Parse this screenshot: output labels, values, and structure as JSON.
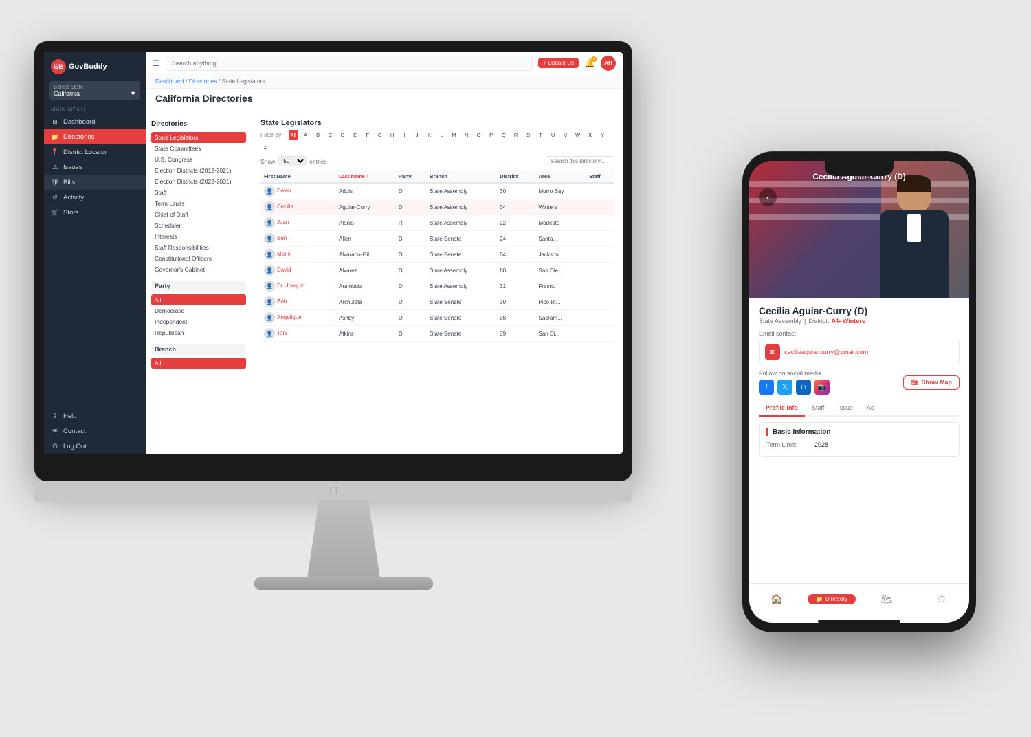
{
  "app": {
    "logo": "GovBuddy",
    "logo_icon": "GB",
    "search_placeholder": "Search anything..."
  },
  "state_selector": {
    "label": "Select State",
    "value": "California"
  },
  "sidebar": {
    "menu_label": "Main Menu",
    "items": [
      {
        "id": "dashboard",
        "label": "Dashboard",
        "icon": "⊞"
      },
      {
        "id": "directories",
        "label": "Directories",
        "icon": "📁",
        "active": true
      },
      {
        "id": "district-locator",
        "label": "District Locator",
        "icon": "📍"
      },
      {
        "id": "issues",
        "label": "Issues",
        "icon": "⚠"
      },
      {
        "id": "bills",
        "label": "Bills",
        "icon": "🛡"
      },
      {
        "id": "activity",
        "label": "Activity",
        "icon": "↺"
      },
      {
        "id": "store",
        "label": "Store",
        "icon": "🛒"
      },
      {
        "id": "help",
        "label": "Help",
        "icon": "?"
      },
      {
        "id": "contact",
        "label": "Contact",
        "icon": "✉"
      },
      {
        "id": "logout",
        "label": "Log Out",
        "icon": "⏻"
      }
    ]
  },
  "topbar": {
    "update_label": "Update Us",
    "notification_count": "1",
    "avatar_initials": "AH"
  },
  "breadcrumb": {
    "parts": [
      "Dashboard",
      "Directories",
      "State Legislators"
    ]
  },
  "page_title": "California Directories",
  "directories_panel": {
    "title": "Directories",
    "items": [
      {
        "label": "State Legislators",
        "active": true
      },
      {
        "label": "State Committees"
      },
      {
        "label": "U.S. Congress"
      },
      {
        "label": "Election Districts (2012-2021)"
      },
      {
        "label": "Election Districts (2022-2031)"
      },
      {
        "label": "Staff"
      },
      {
        "label": "Term Limits"
      },
      {
        "label": "Chief of Staff"
      },
      {
        "label": "Scheduler"
      },
      {
        "label": "Interests"
      },
      {
        "label": "Staff Responsibilities"
      },
      {
        "label": "Constitutional Officers"
      },
      {
        "label": "Governor's Cabinet"
      }
    ],
    "party_section": "Party",
    "party_items": [
      {
        "label": "All",
        "active": true
      },
      {
        "label": "Democratic"
      },
      {
        "label": "Independent"
      },
      {
        "label": "Republican"
      }
    ],
    "branch_section": "Branch",
    "branch_items": [
      {
        "label": "All",
        "active": true
      }
    ]
  },
  "table_section": {
    "title": "State Legislators",
    "filter_label": "Filter by",
    "letters": [
      "All",
      "A",
      "B",
      "C",
      "D",
      "E",
      "F",
      "G",
      "H",
      "I",
      "J",
      "K",
      "L",
      "M",
      "N",
      "O",
      "P",
      "Q",
      "R",
      "S",
      "T",
      "U",
      "V",
      "W",
      "X",
      "Y",
      "Z"
    ],
    "active_letter": "All",
    "show_label": "Show",
    "entries_label": "entries",
    "show_value": "50",
    "search_placeholder": "Search this directory...",
    "columns": [
      {
        "label": "First Name"
      },
      {
        "label": "Last Name ↑",
        "sort": true
      },
      {
        "label": "Party"
      },
      {
        "label": "Branch"
      },
      {
        "label": "District"
      },
      {
        "label": "Area"
      },
      {
        "label": "Staff"
      }
    ],
    "rows": [
      {
        "first": "Dawn",
        "last": "Addis",
        "party": "D",
        "branch": "State Assembly",
        "district": "30",
        "area": "Morro Bay"
      },
      {
        "first": "Cecilia",
        "last": "Aguiar-Curry",
        "party": "D",
        "branch": "State Assembly",
        "district": "04",
        "area": "Winters",
        "selected": true
      },
      {
        "first": "Juan",
        "last": "Alanis",
        "party": "R",
        "branch": "State Assembly",
        "district": "22",
        "area": "Modesto"
      },
      {
        "first": "Ben",
        "last": "Allen",
        "party": "D",
        "branch": "State Senate",
        "district": "24",
        "area": "Santa..."
      },
      {
        "first": "Marie",
        "last": "Alvarado-Gil",
        "party": "D",
        "branch": "State Senate",
        "district": "04",
        "area": "Jackson"
      },
      {
        "first": "David",
        "last": "Alvarez",
        "party": "D",
        "branch": "State Assembly",
        "district": "80",
        "area": "San Die..."
      },
      {
        "first": "Dr. Joaquin",
        "last": "Arambula",
        "party": "D",
        "branch": "State Assembly",
        "district": "31",
        "area": "Fresno"
      },
      {
        "first": "Bob",
        "last": "Archuleta",
        "party": "D",
        "branch": "State Senate",
        "district": "30",
        "area": "Pico Ri..."
      },
      {
        "first": "Angelique",
        "last": "Ashby",
        "party": "D",
        "branch": "State Senate",
        "district": "08",
        "area": "Sacram..."
      },
      {
        "first": "Toni",
        "last": "Atkins",
        "party": "D",
        "branch": "State Senate",
        "district": "39",
        "area": "San Di..."
      }
    ]
  },
  "phone": {
    "person_name": "Cecilia Aguiar-Curry (D)",
    "assembly": "State Assembly",
    "district_label": "District:",
    "district_value": "04- Winters",
    "email_label": "Email contact",
    "email": "ceciliaaguiar.curry@gmail.com",
    "social_label": "Follow on social media",
    "show_map_label": "Show Map",
    "tabs": [
      {
        "label": "Profile Info",
        "active": true
      },
      {
        "label": "Staff"
      },
      {
        "label": "Issue"
      },
      {
        "label": "Ac"
      }
    ],
    "basic_info_title": "Basic Information",
    "term_limit_label": "Term Limit:",
    "term_limit_value": "2028",
    "bottom_nav": [
      {
        "icon": "🏠",
        "label": ""
      },
      {
        "icon": "📁",
        "label": "Directory",
        "active": true
      },
      {
        "icon": "🗺",
        "label": ""
      },
      {
        "icon": "⏱",
        "label": ""
      }
    ]
  }
}
